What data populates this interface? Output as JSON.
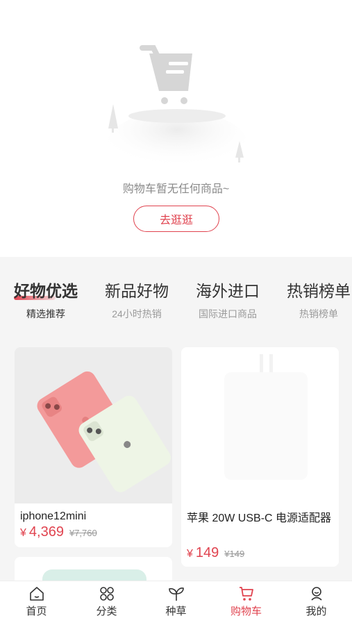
{
  "empty_cart": {
    "message": "购物车暂无任何商品~",
    "browse_button": "去逛逛",
    "illustration_icon": "empty-cart-illustration"
  },
  "tabs": [
    {
      "title": "好物优选",
      "subtitle": "精选推荐",
      "active": true
    },
    {
      "title": "新品好物",
      "subtitle": "24小时热销",
      "active": false
    },
    {
      "title": "海外进口",
      "subtitle": "国际进口商品",
      "active": false
    },
    {
      "title": "热销榜单",
      "subtitle": "热销榜单",
      "active": false
    }
  ],
  "products": [
    {
      "title": "iphone12mini",
      "currency": "¥",
      "price": "4,369",
      "old_price": "¥7,760"
    },
    {
      "title": "苹果 20W USB-C 电源适配器",
      "currency": "¥",
      "price": "149",
      "old_price": "¥149"
    }
  ],
  "tabbar": [
    {
      "label": "首页",
      "icon": "home-icon"
    },
    {
      "label": "分类",
      "icon": "category-icon"
    },
    {
      "label": "种草",
      "icon": "sprout-icon"
    },
    {
      "label": "购物车",
      "icon": "cart-icon",
      "active": true
    },
    {
      "label": "我的",
      "icon": "profile-icon"
    }
  ],
  "colors": {
    "accent": "#e0434f",
    "background": "#f5f5f5"
  }
}
